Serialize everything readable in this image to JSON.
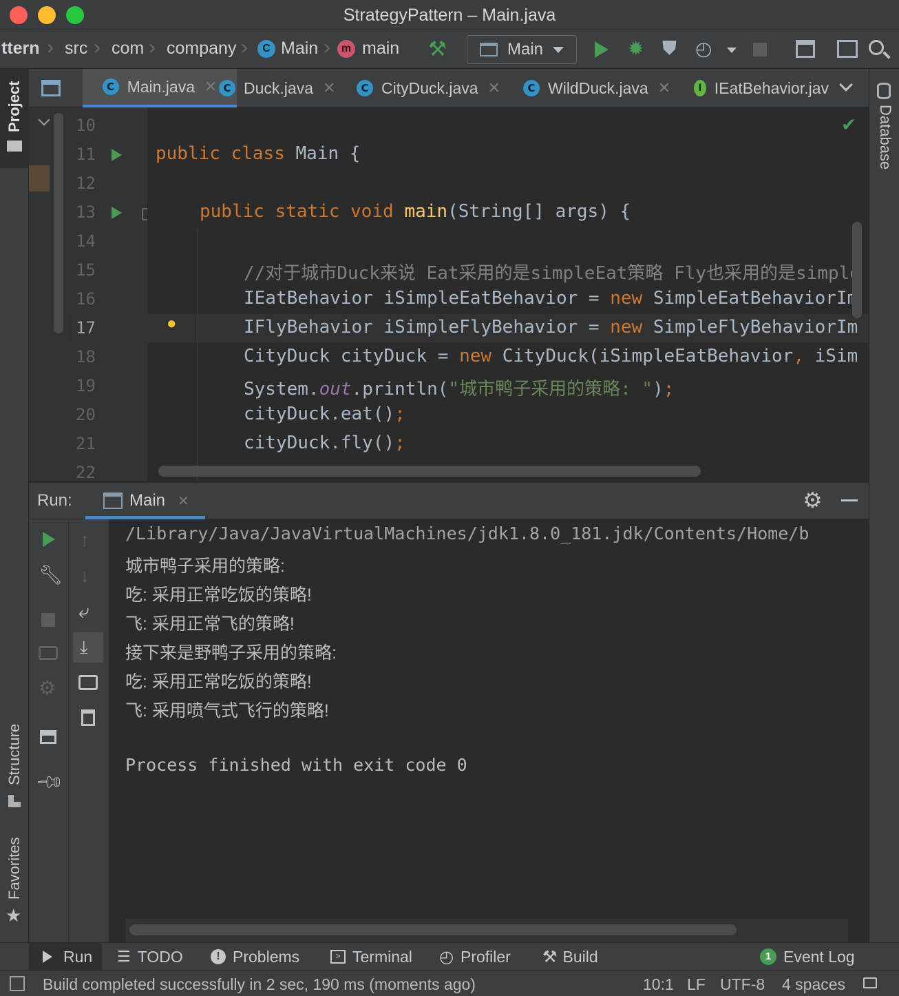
{
  "window": {
    "title": "StrategyPattern – Main.java"
  },
  "breadcrumbs": [
    "ttern",
    "src",
    "com",
    "company",
    "Main",
    "main"
  ],
  "run_config": {
    "selected": "Main"
  },
  "editor_tabs": [
    {
      "label": "Main.java",
      "icon": "class-icon",
      "active": true
    },
    {
      "label": "Duck.java",
      "icon": "class-icon"
    },
    {
      "label": "CityDuck.java",
      "icon": "class-icon"
    },
    {
      "label": "WildDuck.java",
      "icon": "class-icon"
    },
    {
      "label": "IEatBehavior.jav",
      "icon": "interface-icon"
    }
  ],
  "side_tabs": {
    "project": "Project",
    "database": "Database",
    "structure": "Structure",
    "favorites": "Favorites"
  },
  "line_numbers": [
    "10",
    "11",
    "12",
    "13",
    "14",
    "15",
    "16",
    "17",
    "18",
    "19",
    "20",
    "21",
    "22"
  ],
  "code": {
    "l11": {
      "kw1": "public",
      "kw2": "class",
      "name": "Main",
      "rest": " {"
    },
    "l13": {
      "kw1": "public",
      "kw2": "static",
      "kw3": "void",
      "name": "main",
      "rest": "(String[] args) {"
    },
    "l15": {
      "comment": "//对于城市Duck来说 Eat采用的是simpleEat策略 Fly也采用的是simple"
    },
    "l16": {
      "a": "IEatBehavior iSimpleEatBehavior = ",
      "kw": "new",
      "b": " SimpleEatBehaviorIm"
    },
    "l17": {
      "a": "IFlyBehavior iSimpleFlyBehavior = ",
      "kw": "new",
      "b": " SimpleFlyBehaviorIm"
    },
    "l18": {
      "a": "CityDuck cityDuck = ",
      "kw": "new",
      "b": " CityDuck(iSimpleEatBehavior",
      "c": ",",
      "d": " iSim"
    },
    "l19": {
      "a": "System.",
      "field": "out",
      "b": ".println(",
      "str": "\"城市鸭子采用的策略: \"",
      "c": ")",
      "semi": ";"
    },
    "l20": {
      "a": "cityDuck.eat()",
      "semi": ";"
    },
    "l21": {
      "a": "cityDuck.fly()",
      "semi": ";"
    }
  },
  "run_panel": {
    "label": "Run:",
    "tab": "Main",
    "output": [
      "/Library/Java/JavaVirtualMachines/jdk1.8.0_181.jdk/Contents/Home/b",
      "城市鸭子采用的策略:",
      "吃: 采用正常吃饭的策略!",
      "飞: 采用正常飞的策略!",
      "接下来是野鸭子采用的策略:",
      "吃: 采用正常吃饭的策略!",
      "飞: 采用喷气式飞行的策略!",
      "",
      "Process finished with exit code 0"
    ]
  },
  "bottom_tabs": [
    {
      "label": "Run",
      "icon": "play-icon"
    },
    {
      "label": "TODO",
      "icon": "list-icon"
    },
    {
      "label": "Problems",
      "icon": "alert-icon"
    },
    {
      "label": "Terminal",
      "icon": "terminal-icon"
    },
    {
      "label": "Profiler",
      "icon": "profiler-icon"
    },
    {
      "label": "Build",
      "icon": "hammer-icon"
    }
  ],
  "event_log": {
    "count": "1",
    "label": "Event Log"
  },
  "status": {
    "message": "Build completed successfully in 2 sec, 190 ms (moments ago)",
    "position": "10:1",
    "line_ending": "LF",
    "encoding": "UTF-8",
    "indent": "4 spaces"
  },
  "colors": {
    "accent": "#4a88c7",
    "run_green": "#499c54",
    "keyword": "#cc7832",
    "string": "#6a8759"
  }
}
